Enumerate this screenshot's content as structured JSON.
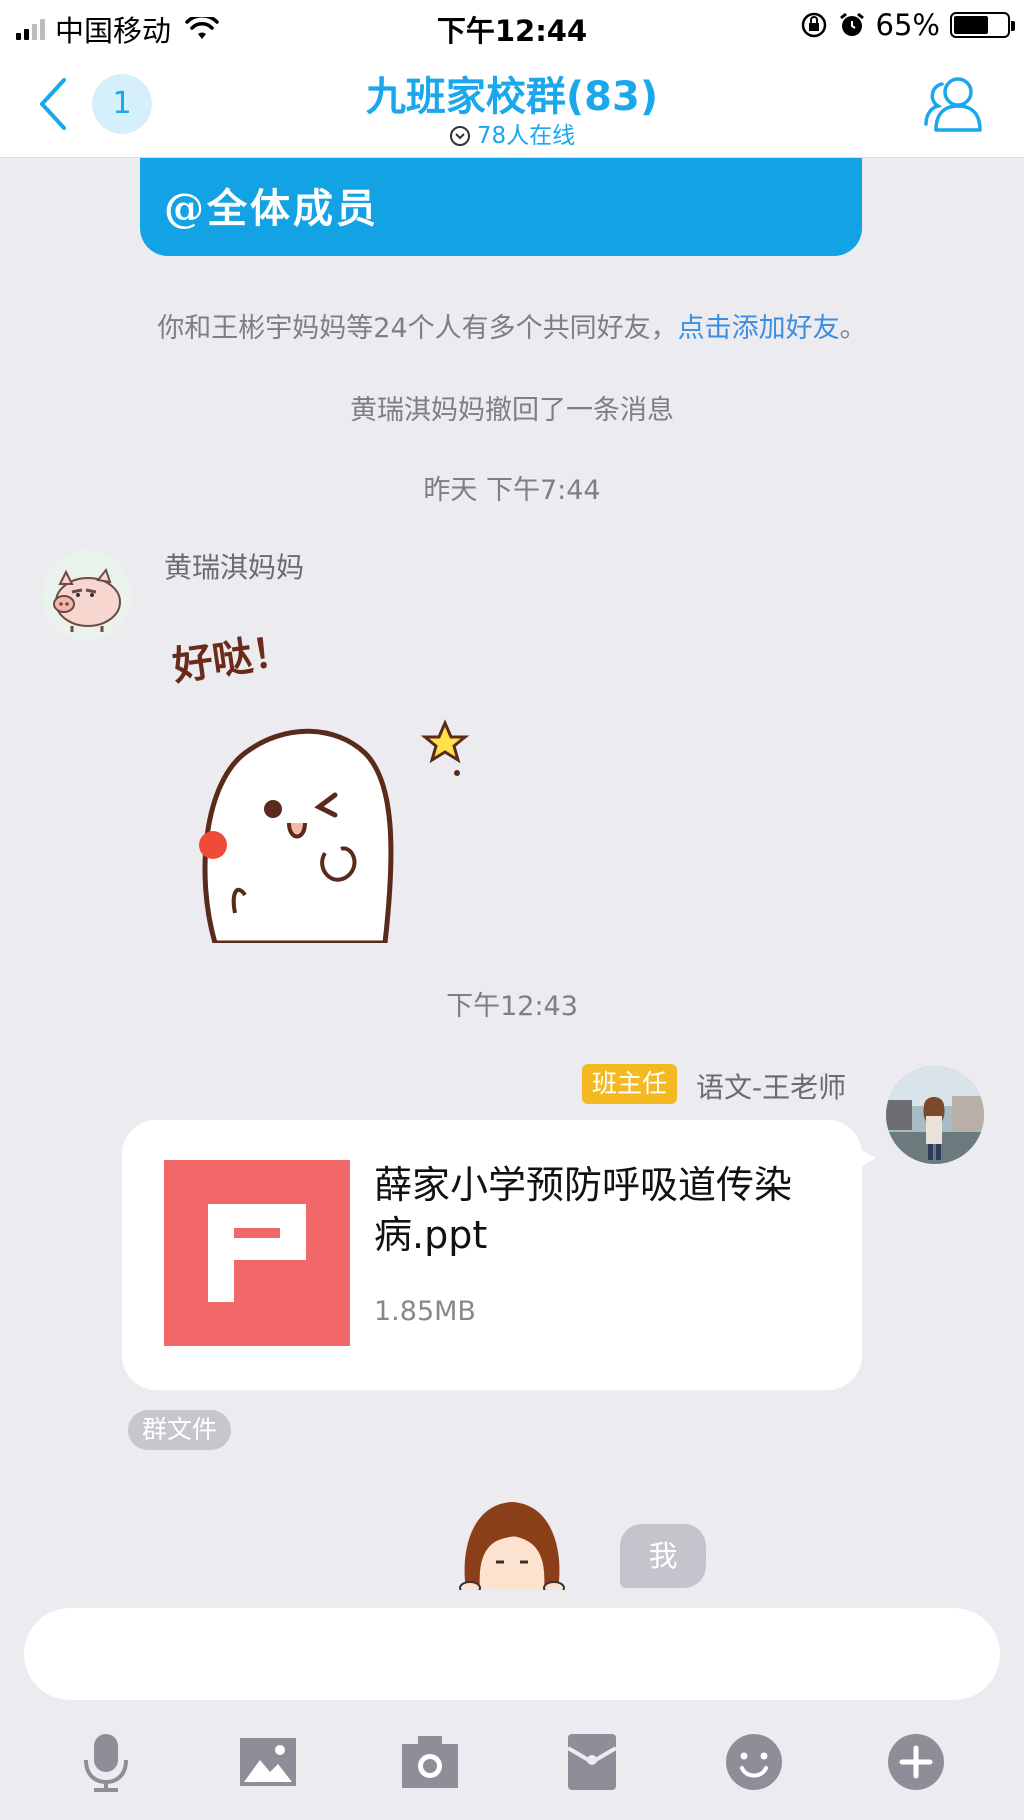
{
  "status_bar": {
    "carrier": "中国移动",
    "time": "下午12:44",
    "battery": "65%",
    "battery_level": 0.65
  },
  "nav": {
    "back_icon": "chevron-left-icon",
    "unread_count": "1",
    "title": "九班家校群(83)",
    "online": "78人在线",
    "members_icon": "group-members-icon",
    "accent_color": "#1aa7ec"
  },
  "chat": {
    "prev_message_tail": "@全体成员",
    "common_friends_text": "你和王彬宇妈妈等24个人有多个共同好友，",
    "add_friend_link": "点击添加好友",
    "add_friend_suffix": "。",
    "recall_notice": "黄瑞淇妈妈撤回了一条消息",
    "timestamp_1": "昨天 下午7:44",
    "msg1": {
      "sender": "黄瑞淇妈妈",
      "sticker_text": "好哒！"
    },
    "timestamp_2": "下午12:43",
    "msg2": {
      "badge": "班主任",
      "sender": "语文-王老师",
      "file_name": "薛家小学预防呼吸道传染病.ppt",
      "file_size": "1.85MB",
      "file_source": "群文件"
    },
    "my_label": "我"
  },
  "input": {
    "placeholder": ""
  },
  "toolbar": {
    "icons": [
      "microphone-icon",
      "image-icon",
      "camera-icon",
      "red-packet-icon",
      "emoji-icon",
      "plus-icon"
    ]
  }
}
